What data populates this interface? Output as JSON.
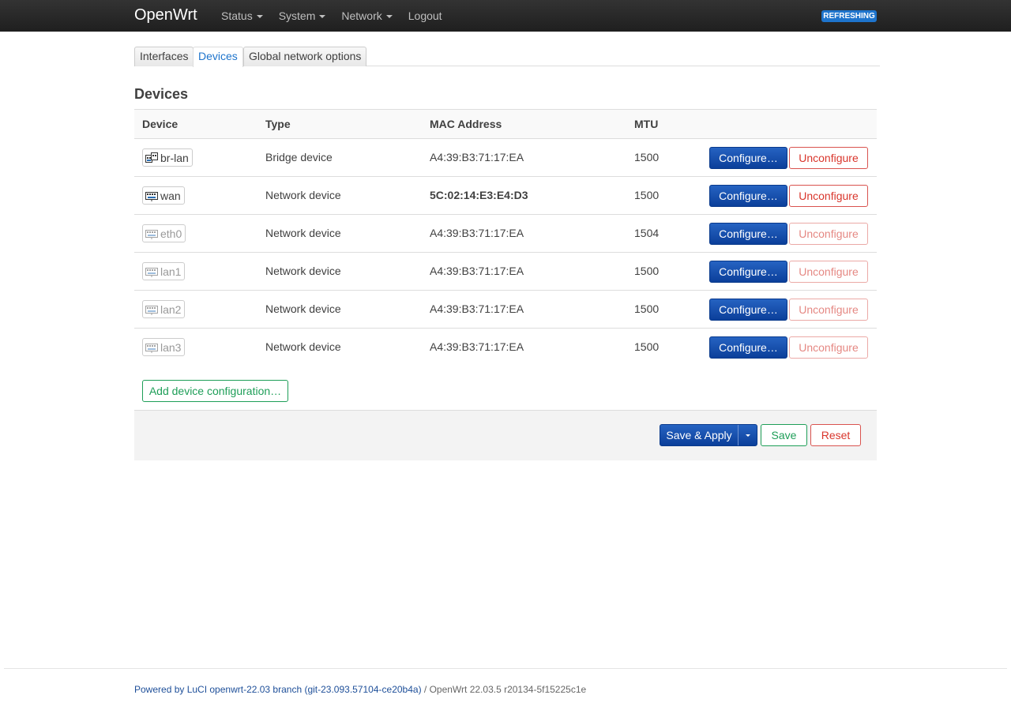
{
  "navbar": {
    "brand": "OpenWrt",
    "menu": [
      {
        "label": "Status",
        "dropdown": true
      },
      {
        "label": "System",
        "dropdown": true
      },
      {
        "label": "Network",
        "dropdown": true
      },
      {
        "label": "Logout",
        "dropdown": false
      }
    ],
    "badge": "REFRESHING"
  },
  "tabs": [
    {
      "label": "Interfaces",
      "active": false
    },
    {
      "label": "Devices",
      "active": true
    },
    {
      "label": "Global network options",
      "active": false
    }
  ],
  "section": {
    "title": "Devices"
  },
  "table": {
    "headers": {
      "device": "Device",
      "type": "Type",
      "mac": "MAC Address",
      "mtu": "MTU"
    },
    "rows": [
      {
        "device": "br-lan",
        "type": "Bridge device",
        "mac": "A4:39:B3:71:17:EA",
        "mtu": "1500",
        "icon": "bridge-icon",
        "dim": false,
        "mac_bold": false
      },
      {
        "device": "wan",
        "type": "Network device",
        "mac": "5C:02:14:E3:E4:D3",
        "mtu": "1500",
        "icon": "ethernet-port-icon",
        "dim": false,
        "mac_bold": true
      },
      {
        "device": "eth0",
        "type": "Network device",
        "mac": "A4:39:B3:71:17:EA",
        "mtu": "1504",
        "icon": "ethernet-port-icon",
        "dim": true,
        "mac_bold": false
      },
      {
        "device": "lan1",
        "type": "Network device",
        "mac": "A4:39:B3:71:17:EA",
        "mtu": "1500",
        "icon": "ethernet-port-icon",
        "dim": true,
        "mac_bold": false
      },
      {
        "device": "lan2",
        "type": "Network device",
        "mac": "A4:39:B3:71:17:EA",
        "mtu": "1500",
        "icon": "ethernet-port-icon",
        "dim": true,
        "mac_bold": false
      },
      {
        "device": "lan3",
        "type": "Network device",
        "mac": "A4:39:B3:71:17:EA",
        "mtu": "1500",
        "icon": "ethernet-port-icon",
        "dim": true,
        "mac_bold": false
      }
    ],
    "configure_label": "Configure…",
    "unconfigure_label": "Unconfigure"
  },
  "add_device_label": "Add device configuration…",
  "actions": {
    "save_apply": "Save & Apply",
    "save": "Save",
    "reset": "Reset"
  },
  "footer": {
    "link": "Powered by LuCI openwrt-22.03 branch (git-23.093.57104-ce20b4a)",
    "text": " / OpenWrt 22.03.5 r20134-5f15225c1e"
  },
  "colors": {
    "accent": "#1e74cc",
    "primary_button": "#0b3f9a",
    "positive": "#1e9e58",
    "negative": "#d9362c"
  }
}
